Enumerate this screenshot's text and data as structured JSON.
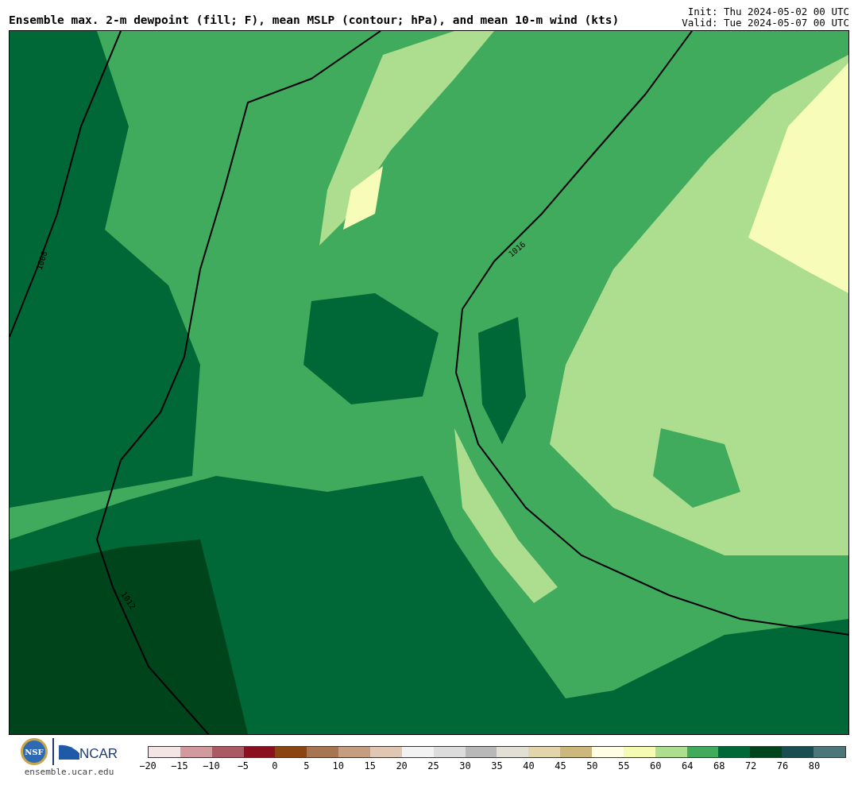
{
  "title": "Ensemble max. 2-m dewpoint (fill; F), mean MSLP (contour; hPa), and mean 10-m wind (kts)",
  "init": "Init: Thu 2024-05-02 00 UTC",
  "valid": "Valid: Tue 2024-05-07 00 UTC",
  "map": {
    "isobars": [
      {
        "label": "1008"
      },
      {
        "label": "1012"
      },
      {
        "label": "1016"
      }
    ]
  },
  "logo": {
    "nsf": "NSF",
    "ncar": "NCAR",
    "url": "ensemble.ucar.edu"
  },
  "colorbar": {
    "bins": [
      {
        "color": "#f3e5e5"
      },
      {
        "color": "#d09a9e"
      },
      {
        "color": "#ab5962"
      },
      {
        "color": "#8b1020"
      },
      {
        "color": "#8b4512"
      },
      {
        "color": "#a87553"
      },
      {
        "color": "#c59e82"
      },
      {
        "color": "#e0c7b4"
      },
      {
        "color": "#f2f2f2"
      },
      {
        "color": "#dcdcdc"
      },
      {
        "color": "#b8b8b8"
      },
      {
        "color": "#e2e0d4"
      },
      {
        "color": "#e2d4ab"
      },
      {
        "color": "#ccb77c"
      },
      {
        "color": "#fffde4"
      },
      {
        "color": "#f6fbb4"
      },
      {
        "color": "#addd8e"
      },
      {
        "color": "#41ab5d"
      },
      {
        "color": "#006837"
      },
      {
        "color": "#00441b"
      },
      {
        "color": "#1a4d51"
      },
      {
        "color": "#4d7678"
      }
    ],
    "ticks": [
      "−20",
      "−15",
      "−10",
      "−5",
      "0",
      "5",
      "10",
      "15",
      "20",
      "25",
      "30",
      "35",
      "40",
      "45",
      "50",
      "55",
      "60",
      "64",
      "68",
      "72",
      "76",
      "80"
    ]
  }
}
